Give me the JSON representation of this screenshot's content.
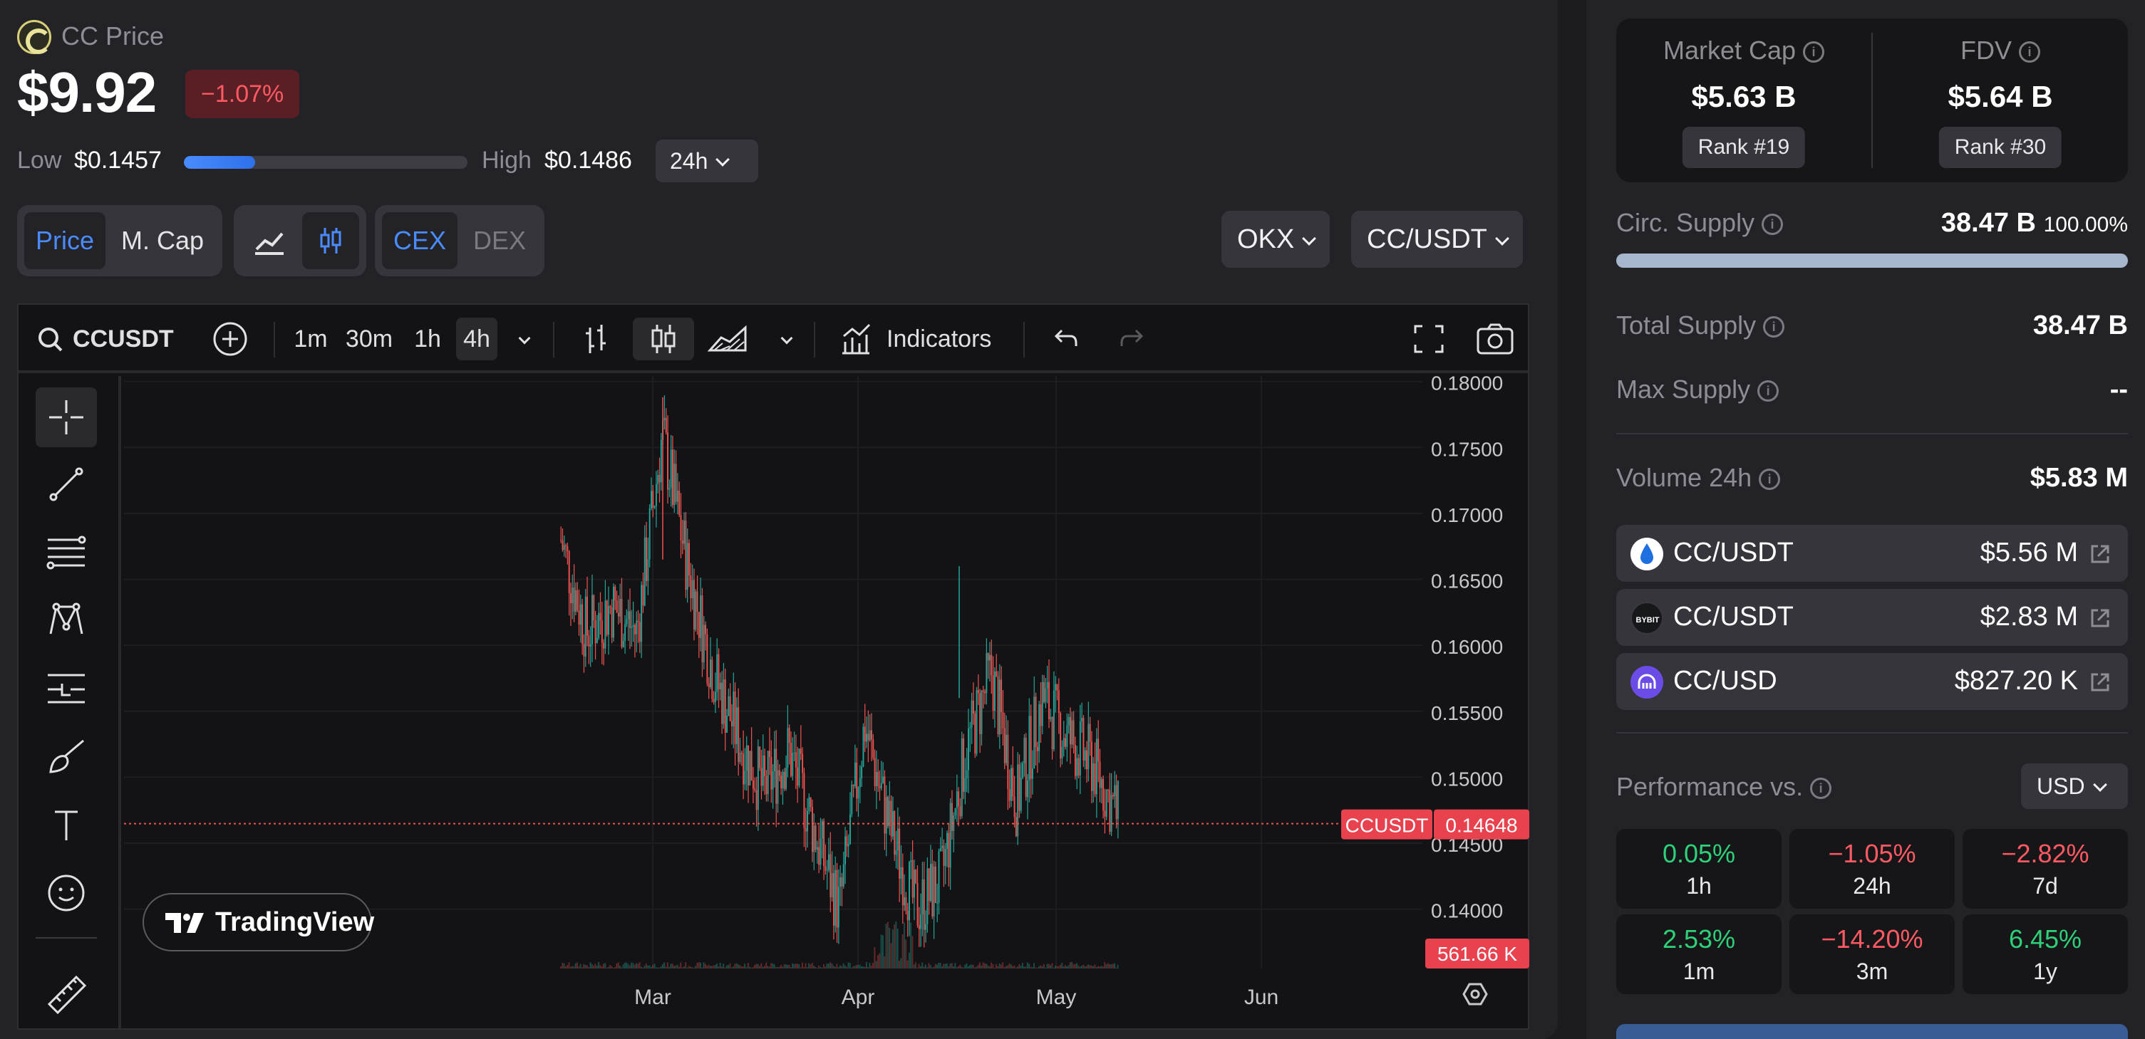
{
  "header": {
    "title": "CC Price",
    "price": "$9.92",
    "change": "−1.07%",
    "low_label": "Low",
    "low_value": "$0.1457",
    "high_label": "High",
    "high_value": "$0.1486",
    "range_position": 0.25,
    "period": "24h"
  },
  "toggles": {
    "price": "Price",
    "mcap": "M. Cap",
    "cex": "CEX",
    "dex": "DEX",
    "exchange": "OKX",
    "pair": "CC/USDT"
  },
  "chart_toolbar": {
    "symbol": "CCUSDT",
    "intervals": [
      "1m",
      "30m",
      "1h",
      "4h"
    ],
    "active_interval": "4h",
    "indicators": "Indicators"
  },
  "chart_data": {
    "type": "candlestick",
    "symbol": "CCUSDT",
    "y_ticks": [
      "0.18000",
      "0.17500",
      "0.17000",
      "0.16500",
      "0.16000",
      "0.15500",
      "0.15000",
      "0.14500",
      "0.14000"
    ],
    "ylim": [
      0.1355,
      0.1802
    ],
    "x_ticks": [
      "Mar",
      "Apr",
      "May",
      "Jun"
    ],
    "last_price": "0.14648",
    "last_price_value": 0.14648,
    "volume_label": "561.66 K",
    "colors": {
      "up": "#26a69a",
      "down": "#ef5350"
    },
    "trajectory": [
      {
        "x": "Feb 14",
        "close": 0.168
      },
      {
        "x": "Feb 17",
        "close": 0.161
      },
      {
        "x": "Feb 20",
        "close": 0.163
      },
      {
        "x": "Feb 24",
        "close": 0.161
      },
      {
        "x": "Feb 27",
        "close": 0.176
      },
      {
        "x": "Mar 2",
        "close": 0.166
      },
      {
        "x": "Mar 5",
        "close": 0.158
      },
      {
        "x": "Mar 9",
        "close": 0.153
      },
      {
        "x": "Mar 12",
        "close": 0.149
      },
      {
        "x": "Mar 16",
        "close": 0.152
      },
      {
        "x": "Mar 20",
        "close": 0.146
      },
      {
        "x": "Mar 25",
        "close": 0.14
      },
      {
        "x": "Mar 28",
        "close": 0.154
      },
      {
        "x": "Apr 1",
        "close": 0.146
      },
      {
        "x": "Apr 6",
        "close": 0.14
      },
      {
        "x": "Apr 10",
        "close": 0.142
      },
      {
        "x": "Apr 15",
        "close": 0.152
      },
      {
        "x": "Apr 18",
        "close": 0.158
      },
      {
        "x": "Apr 22",
        "close": 0.148
      },
      {
        "x": "Apr 26",
        "close": 0.156
      },
      {
        "x": "Apr 30",
        "close": 0.153
      },
      {
        "x": "May 3",
        "close": 0.151
      },
      {
        "x": "May 7",
        "close": 0.147
      }
    ]
  },
  "watermark": "TradingView",
  "stats": {
    "market_cap_label": "Market Cap",
    "market_cap": "$5.63 B",
    "market_cap_rank": "Rank #19",
    "fdv_label": "FDV",
    "fdv": "$5.64 B",
    "fdv_rank": "Rank #30",
    "circ_supply_label": "Circ. Supply",
    "circ_supply": "38.47 B",
    "circ_supply_pct": "100.00%",
    "circ_supply_fraction": 1.0,
    "total_supply_label": "Total Supply",
    "total_supply": "38.47 B",
    "max_supply_label": "Max Supply",
    "max_supply": "--",
    "volume_label": "Volume 24h",
    "volume": "$5.83 M"
  },
  "pairs": [
    {
      "name": "CC/USDT",
      "volume": "$5.56 M",
      "icon": "drop-logo-icon"
    },
    {
      "name": "CC/USDT",
      "volume": "$2.83 M",
      "icon": "bybit-logo-icon"
    },
    {
      "name": "CC/USD",
      "volume": "$827.20 K",
      "icon": "kraken-logo-icon"
    }
  ],
  "performance": {
    "label": "Performance vs.",
    "currency": "USD",
    "cells": [
      {
        "value": "0.05%",
        "period": "1h",
        "dir": "up"
      },
      {
        "value": "−1.05%",
        "period": "24h",
        "dir": "down"
      },
      {
        "value": "−2.82%",
        "period": "7d",
        "dir": "down"
      },
      {
        "value": "2.53%",
        "period": "1m",
        "dir": "up"
      },
      {
        "value": "−14.20%",
        "period": "3m",
        "dir": "down"
      },
      {
        "value": "6.45%",
        "period": "1y",
        "dir": "up"
      }
    ]
  }
}
